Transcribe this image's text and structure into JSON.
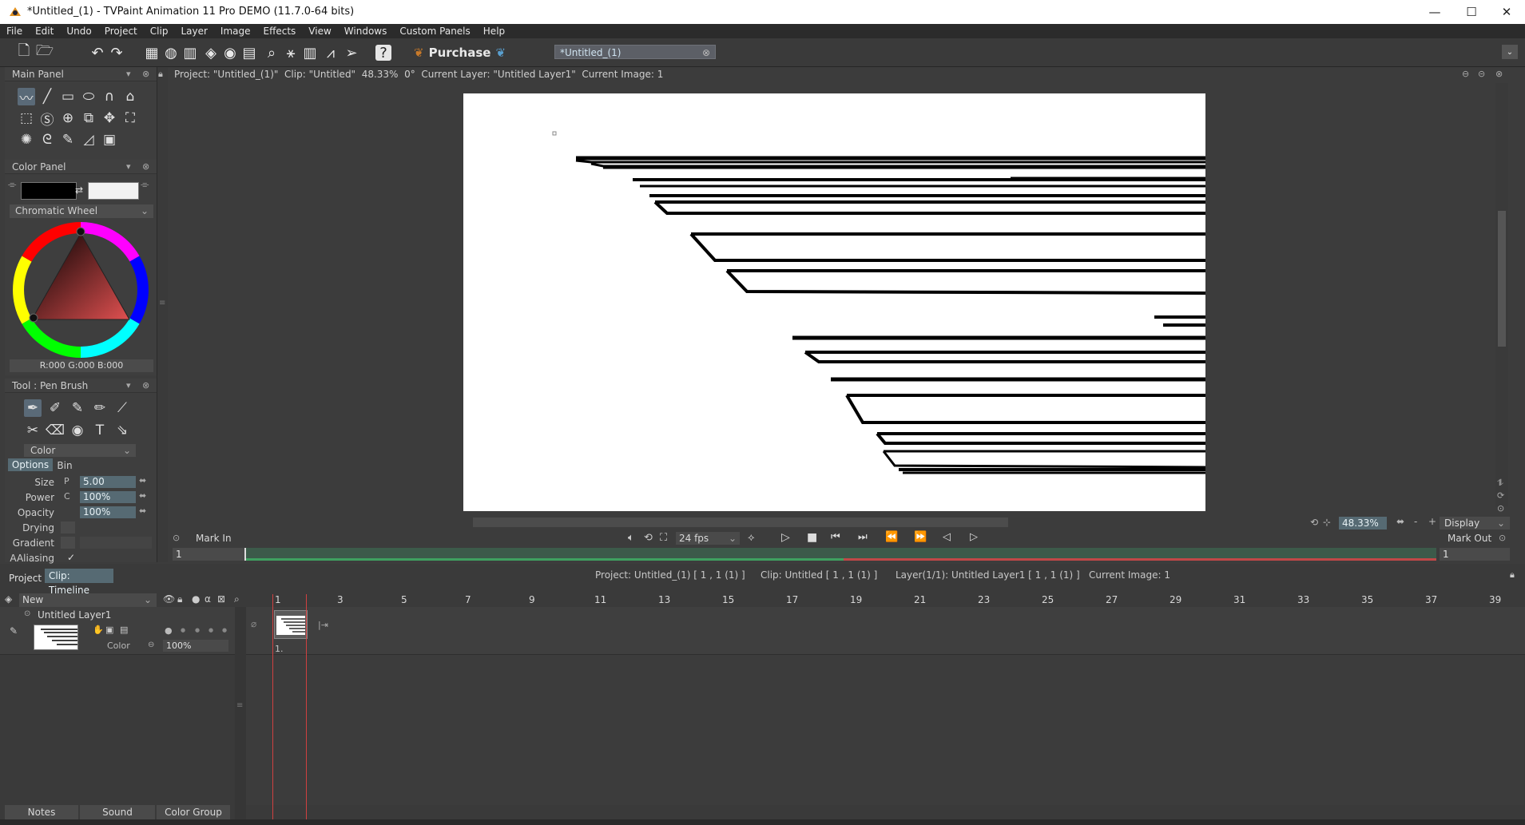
{
  "window": {
    "title": "*Untitled_(1) - TVPaint Animation 11 Pro DEMO (11.7.0-64 bits)",
    "minimize": "—",
    "maximize": "☐",
    "close": "✕"
  },
  "menu": [
    "File",
    "Edit",
    "Undo",
    "Project",
    "Clip",
    "Layer",
    "Image",
    "Effects",
    "View",
    "Windows",
    "Custom Panels",
    "Help"
  ],
  "toolbar": {
    "purchase_label": "Purchase",
    "document_tab": "*Untitled_(1)",
    "document_tab_close": "⊗"
  },
  "main_panel": {
    "title": "Main Panel"
  },
  "color_panel": {
    "title": "Color Panel",
    "mode": "Chromatic Wheel",
    "rgb_readout": "R:000 G:000 B:000",
    "colors": {
      "primary": "#000000",
      "secondary": "#ffffff"
    }
  },
  "tool_panel": {
    "title": "Tool : Pen Brush",
    "mode": "Color",
    "tabs": {
      "options": "Options",
      "bin": "Bin"
    },
    "params": [
      {
        "label": "Size",
        "value": "5.00"
      },
      {
        "label": "Power",
        "value": "100%"
      },
      {
        "label": "Opacity",
        "value": "100%"
      }
    ],
    "drying_label": "Drying",
    "gradient_label": "Gradient",
    "aaliasing_label": "AAliasing",
    "aaliasing_check": "✓"
  },
  "viewport": {
    "info": "Project: \"Untitled_(1)\"  Clip: \"Untitled\"  48.33%  0°  Current Layer: \"Untitled Layer1\"  Current Image: 1",
    "zoom": "48.33%",
    "display_label": "Display",
    "fps": "24 fps",
    "mark_in_label": "Mark In",
    "mark_out_label": "Mark Out",
    "mark_in_value": "1",
    "mark_out_value": "1"
  },
  "timeline": {
    "tabs": {
      "project": "Project",
      "clip_timeline": "Clip: Timeline"
    },
    "status": {
      "project": "Project: Untitled_(1) [ 1 , 1  (1) ]",
      "clip": "Clip: Untitled [ 1 , 1  (1) ]",
      "layer": "Layer(1/1): Untitled Layer1 [ 1 , 1  (1) ]",
      "current_image": "Current Image: 1"
    },
    "new_label": "New",
    "layer_name": "Untitled Layer1",
    "layer_mode": "Color",
    "layer_opacity": "100%",
    "frame_label": "1.",
    "ruler": [
      "1",
      "3",
      "5",
      "7",
      "9",
      "11",
      "13",
      "15",
      "17",
      "19",
      "21",
      "23",
      "25",
      "27",
      "29",
      "31",
      "33",
      "35",
      "37",
      "39"
    ],
    "bottom_buttons": [
      "Notes",
      "Sound",
      "Color Group"
    ]
  }
}
